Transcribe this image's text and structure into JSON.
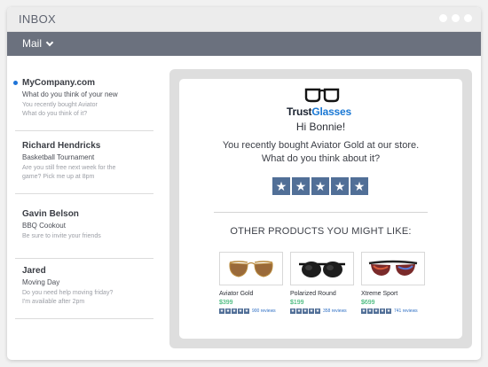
{
  "window": {
    "title": "INBOX"
  },
  "menu": {
    "mail_label": "Mail"
  },
  "mails": [
    {
      "sender": "MyCompany.com",
      "subject": "What do you think of your new",
      "preview": [
        "You recently bought Aviator",
        "What do you think of it?"
      ],
      "unread": true
    },
    {
      "sender": "Richard Hendricks",
      "subject": "Basketball Tournament",
      "preview": [
        "Are you still free next week for the",
        "game? Pick me up at 8pm"
      ],
      "unread": false
    },
    {
      "sender": "Gavin Belson",
      "subject": "BBQ Cookout",
      "preview": [
        "Be sure to invite your friends"
      ],
      "unread": false
    },
    {
      "sender": "Jared",
      "subject": "Moving Day",
      "preview": [
        "Do you need help moving friday?",
        "I'm available after 2pm"
      ],
      "unread": false
    }
  ],
  "email": {
    "logo": {
      "part1": "Trust",
      "part2": "Glasses",
      "icon": "glasses-icon"
    },
    "greeting": "Hi Bonnie!",
    "message_line1": "You recently bought Aviator Gold at our store.",
    "message_line2": "What do you think about it?",
    "rating_stars": 5,
    "other_heading": "OTHER PRODUCTS YOU MIGHT LIKE:",
    "products": [
      {
        "name": "Aviator Gold",
        "price": "$399",
        "reviews": "900 reviews",
        "stars": 5,
        "icon": "aviator-sunglasses-icon"
      },
      {
        "name": "Polarized Round",
        "price": "$199",
        "reviews": "358 reviews",
        "stars": 5,
        "icon": "round-sunglasses-icon"
      },
      {
        "name": "Xtreme Sport",
        "price": "$699",
        "reviews": "741 reviews",
        "stars": 5,
        "icon": "sport-sunglasses-icon"
      }
    ]
  },
  "colors": {
    "accent": "#1a78d4",
    "star_bg": "#516f97",
    "price": "#18a85b",
    "menubar": "#6b717e"
  }
}
